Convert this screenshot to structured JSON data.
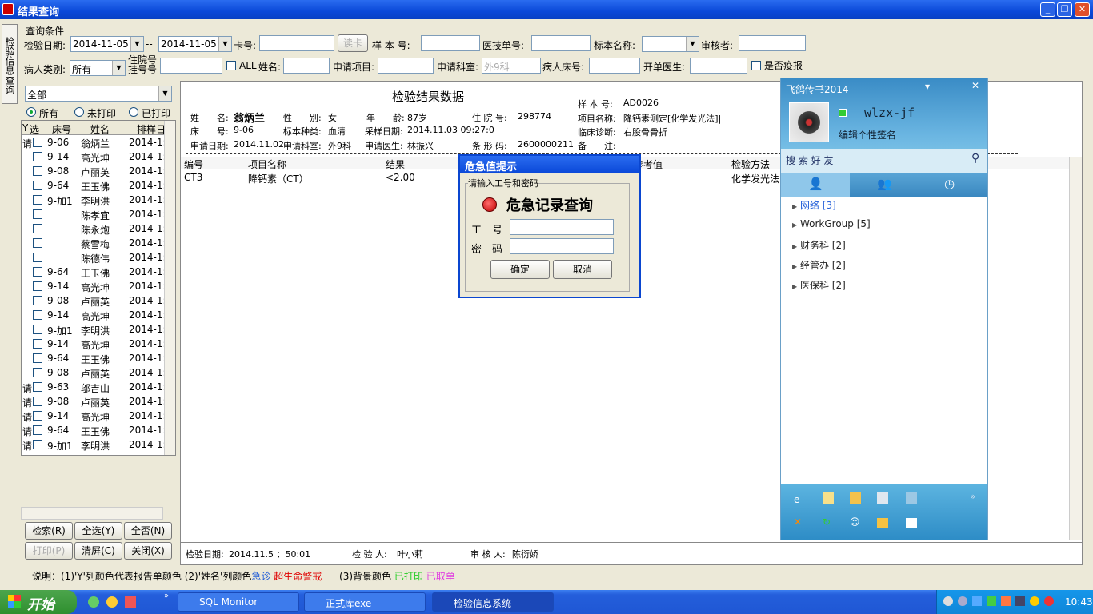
{
  "window": {
    "title": "结果查询"
  },
  "sidetab": {
    "label": "检验信息查询"
  },
  "query": {
    "group_label": "查询条件",
    "date_label": "检验日期:",
    "date_from": "2014-11-05",
    "date_sep": "--",
    "date_to": "2014-11-05",
    "card_label": "卡号:",
    "card_value": "",
    "read_card_btn": "读卡",
    "sample_no_label": "样 本 号:",
    "sample_no_value": "",
    "tech_no_label": "医技单号:",
    "tech_no_value": "",
    "specimen_label": "标本名称:",
    "specimen_value": "",
    "auditor_label": "审核者:",
    "auditor_value": "",
    "patient_type_label": "病人类别:",
    "patient_type_value": "所有",
    "inpatient_label_1": "住院号",
    "inpatient_label_2": "挂号号",
    "inpatient_value": "",
    "all_label": "ALL",
    "name_label": "姓名:",
    "name_value": "",
    "apply_item_label": "申请项目:",
    "apply_item_value": "",
    "apply_dept_label": "申请科室:",
    "apply_dept_placeholder": "外9科",
    "bed_label": "病人床号:",
    "bed_value": "",
    "doctor_label": "开单医生:",
    "doctor_value": "",
    "epidemic_label": "是否疫报"
  },
  "leftlist": {
    "filter_value": "全部",
    "radio_all": "所有",
    "radio_unprinted": "未打印",
    "radio_printed": "已打印",
    "columns": [
      "Y",
      "选",
      "床号",
      "姓名",
      "排样日"
    ],
    "rows": [
      {
        "y": "请",
        "bed": "9-06",
        "name": "翁炳兰",
        "date": "2014-1:"
      },
      {
        "y": "",
        "bed": "9-14",
        "name": "高光坤",
        "date": "2014-1:"
      },
      {
        "y": "",
        "bed": "9-08",
        "name": "卢丽英",
        "date": "2014-1:"
      },
      {
        "y": "",
        "bed": "9-64",
        "name": "王玉佛",
        "date": "2014-1:"
      },
      {
        "y": "",
        "bed": "9-加1",
        "name": "李明洪",
        "date": "2014-1:"
      },
      {
        "y": "",
        "bed": "",
        "name": "陈孝宜",
        "date": "2014-1:"
      },
      {
        "y": "",
        "bed": "",
        "name": "陈永炮",
        "date": "2014-1:"
      },
      {
        "y": "",
        "bed": "",
        "name": "蔡雪梅",
        "date": "2014-1:"
      },
      {
        "y": "",
        "bed": "",
        "name": "陈德伟",
        "date": "2014-1:"
      },
      {
        "y": "",
        "bed": "9-64",
        "name": "王玉佛",
        "date": "2014-1:"
      },
      {
        "y": "",
        "bed": "9-14",
        "name": "高光坤",
        "date": "2014-1:"
      },
      {
        "y": "",
        "bed": "9-08",
        "name": "卢丽英",
        "date": "2014-1:"
      },
      {
        "y": "",
        "bed": "9-14",
        "name": "高光坤",
        "date": "2014-1:"
      },
      {
        "y": "",
        "bed": "9-加1",
        "name": "李明洪",
        "date": "2014-1:"
      },
      {
        "y": "",
        "bed": "9-14",
        "name": "高光坤",
        "date": "2014-1:"
      },
      {
        "y": "",
        "bed": "9-64",
        "name": "王玉佛",
        "date": "2014-1:"
      },
      {
        "y": "",
        "bed": "9-08",
        "name": "卢丽英",
        "date": "2014-1:"
      },
      {
        "y": "请",
        "bed": "9-63",
        "name": "邬吉山",
        "date": "2014-1:"
      },
      {
        "y": "请",
        "bed": "9-08",
        "name": "卢丽英",
        "date": "2014-1:"
      },
      {
        "y": "请",
        "bed": "9-14",
        "name": "高光坤",
        "date": "2014-1:"
      },
      {
        "y": "请",
        "bed": "9-64",
        "name": "王玉佛",
        "date": "2014-1:"
      },
      {
        "y": "请",
        "bed": "9-加1",
        "name": "李明洪",
        "date": "2014-1:"
      }
    ],
    "btn_search": "检索(R)",
    "btn_selectall": "全选(Y)",
    "btn_selectnone": "全否(N)",
    "btn_print": "打印(P)",
    "btn_clear": "清屏(C)",
    "btn_close": "关闭(X)"
  },
  "result": {
    "title": "检验结果数据",
    "name_label": "姓　　名:",
    "name_value": "翁炳兰",
    "sex_label": "性　　别:",
    "sex_value": "女",
    "age_label": "年　　龄:",
    "age_value": "87岁",
    "inpatient_label": "住 院 号:",
    "inpatient_value": "298774",
    "sample_label": "样 本 号:",
    "sample_value": "AD0026",
    "item_label": "项目名称:",
    "item_value": "降钙素测定[化学发光法]|",
    "bed_label": "床　　号:",
    "bed_value": "9-06",
    "specimen_label": "标本种类:",
    "specimen_value": "血清",
    "collect_label": "采样日期:",
    "collect_value": "2014.11.03 09:27:0",
    "diag_label": "临床诊断:",
    "diag_value": "右股骨骨折",
    "apply_date_label": "申请日期:",
    "apply_date_value": "2014.11.02",
    "apply_dept_label": "申请科室:",
    "apply_dept_value": "外9科",
    "apply_doc_label": "申请医生:",
    "apply_doc_value": "林振兴",
    "barcode_label": "条 形 码:",
    "barcode_value": "2600000211",
    "remark_label": "备　　注:",
    "remark_value": "",
    "columns": [
      "编号",
      "项目名称",
      "结果",
      "参考值",
      "检验方法"
    ],
    "rows": [
      {
        "code": "CT3",
        "item": "降钙素（CT）",
        "result": "<2.00",
        "ref": "",
        "method": "化学发光法"
      }
    ],
    "footer_date_label": "检验日期:",
    "footer_date_value": "2014.11.5 ：50:01",
    "footer_tester_label": "检 验 人:",
    "footer_tester_value": "叶小莉",
    "footer_auditor_label": "审 核 人:",
    "footer_auditor_value": "陈衍娇"
  },
  "legend": {
    "prefix": "说明：(1)'Y'列颜色代表报告单颜色  (2)'姓名'列颜色",
    "urgent": "急诊",
    "critical": "超生命警戒",
    "bg": "(3)背景颜色",
    "printed": "已打印",
    "cancelled": "已取单",
    "colors": {
      "urgent": "#1e5bd8",
      "critical": "#e00000",
      "printed": "#22cc22",
      "cancelled": "#e040e0"
    }
  },
  "dialog": {
    "title": "危急值提示",
    "group_label": "请输入工号和密码",
    "heading": "危急记录查询",
    "id_label": "工　号",
    "id_value": "",
    "pwd_label": "密　码",
    "pwd_value": "",
    "ok": "确定",
    "cancel": "取消"
  },
  "feixin": {
    "title": "飞鸽传书2014",
    "user": "wlzx-jf",
    "signature": "编辑个性签名",
    "search": "搜 索 好 友",
    "groups": [
      "网络 [3]",
      "WorkGroup [5]",
      "财务科 [2]",
      "经管办 [2]",
      "医保科 [2]"
    ]
  },
  "taskbar": {
    "start": "开始",
    "tasks": [
      "SQL Monitor",
      "正式库exe",
      "检验信息系统"
    ],
    "clock": "10:43"
  }
}
